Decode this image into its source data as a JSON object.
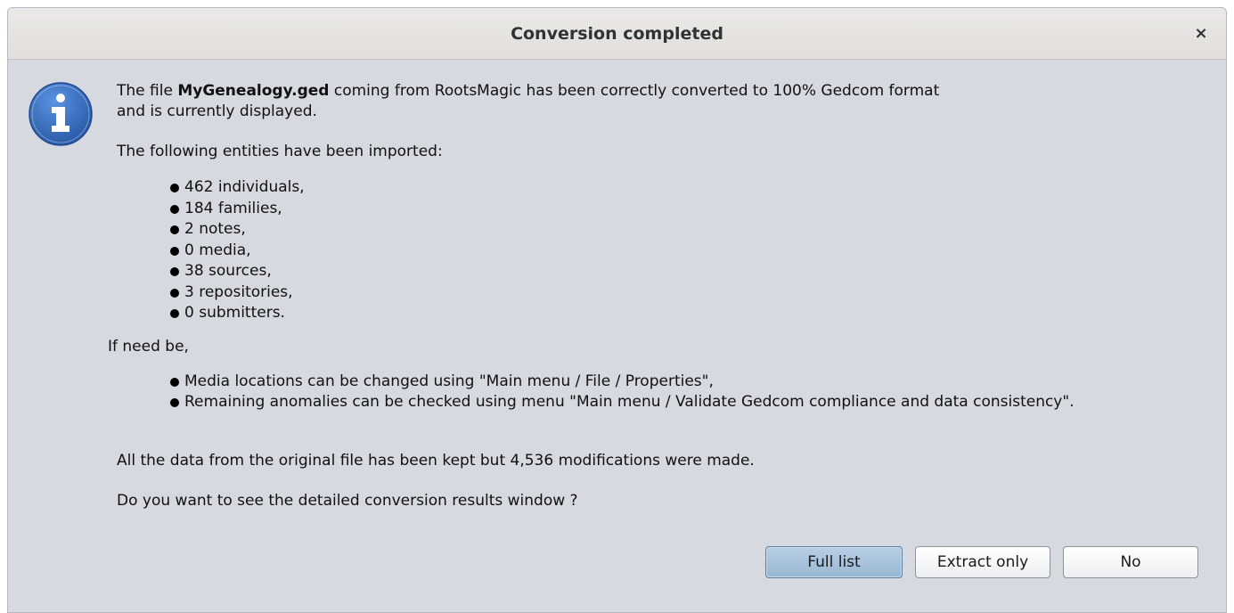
{
  "dialog": {
    "title": "Conversion completed",
    "close_glyph": "×",
    "icon": "info-icon",
    "message": {
      "line1_pre": "The file ",
      "filename": "MyGenealogy.ged",
      "line1_post": " coming from RootsMagic has been correctly converted to 100% Gedcom format",
      "line2": "and is currently displayed.",
      "entities_intro": "The following entities have been imported:",
      "entities": [
        "462 individuals,",
        "184 families,",
        "2 notes,",
        "0 media,",
        "38 sources,",
        "3 repositories,",
        "0 submitters."
      ],
      "advice_intro": "If need be,",
      "advice": [
        "Media locations can be changed using \"Main menu / File / Properties\",",
        "Remaining anomalies can be checked using menu \"Main menu / Validate Gedcom compliance and data consistency\"."
      ],
      "summary": "All the data from the original file has been kept but 4,536 modifications were made.",
      "question": "Do you want to see the detailed conversion results window ?"
    },
    "buttons": {
      "full_list": "Full list",
      "extract_only": "Extract only",
      "no": "No"
    },
    "colors": {
      "background": "#d6d9df",
      "titlebar": "#e6e3e0",
      "icon_blue": "#3a6fc0",
      "default_button": "#a8c2dc"
    }
  }
}
